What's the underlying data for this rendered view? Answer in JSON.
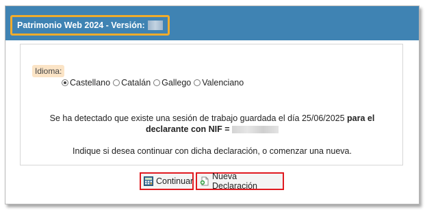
{
  "header": {
    "title": "Patrimonio Web 2024 - Versión:"
  },
  "language": {
    "label": "Idioma:",
    "options": [
      {
        "label": "Castellano",
        "selected": true
      },
      {
        "label": "Catalán",
        "selected": false
      },
      {
        "label": "Gallego",
        "selected": false
      },
      {
        "label": "Valenciano",
        "selected": false
      }
    ]
  },
  "message": {
    "line1_prefix": "Se ha detectado que existe una sesión de trabajo guardada el día 25/06/2025",
    "line1_bold": "para el",
    "line2_bold": "declarante con NIF =",
    "instruction": "Indique si desea continuar con dicha declaración, o comenzar una nueva."
  },
  "buttons": {
    "continue_label": "Continuar",
    "new_label": "Nueva Declaración"
  },
  "colors": {
    "header": "#3f83b3",
    "title_highlight": "#f0ac2c",
    "button_highlight": "#e0191f",
    "label_bg": "#fbe4c6"
  },
  "icons": {
    "continue": "calculator-icon",
    "new": "new-document-icon"
  }
}
